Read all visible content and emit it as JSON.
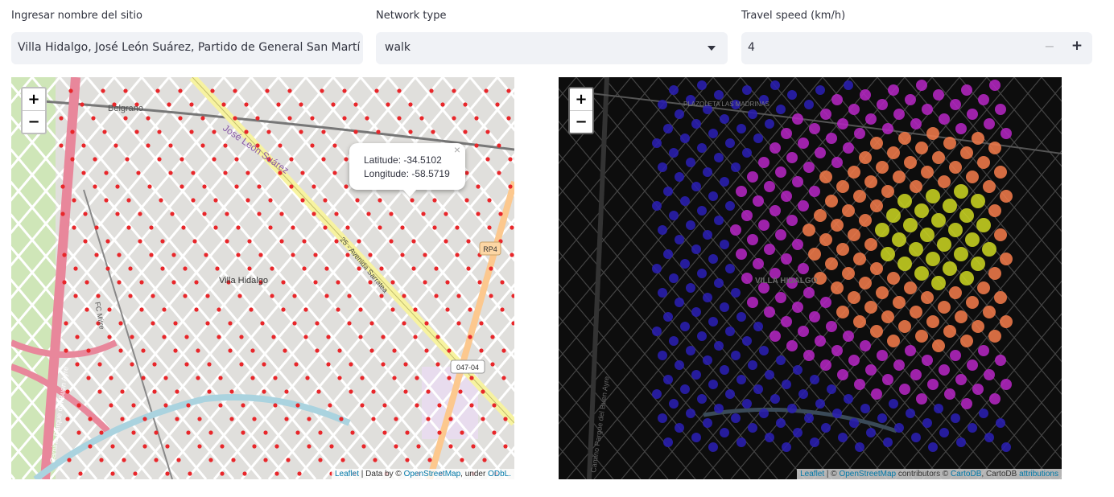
{
  "controls": {
    "site": {
      "label": "Ingresar nombre del sitio",
      "value": "Villa Hidalgo, José León Suárez, Partido de General San Martín,"
    },
    "network": {
      "label": "Network type",
      "value": "walk"
    },
    "speed": {
      "label": "Travel speed (km/h)",
      "value": "4",
      "minus": "−",
      "plus": "+"
    }
  },
  "map_left": {
    "zoom_in": "+",
    "zoom_out": "−",
    "popup": {
      "latitude": "Latitude: -34.5102",
      "longitude": "Longitude: -58.5719",
      "close": "×"
    },
    "labels": {
      "belgrano": "Belgrano",
      "jose_leon": "José León Suárez",
      "villa": "Villa Hidalgo",
      "rp4": "RP4",
      "route": "047-04",
      "camino": "Camino Parque del Buen Ayre",
      "fc": "FC Mitre",
      "avenue": "25 - Avenida Sarratea"
    },
    "attribution": {
      "leaflet": "Leaflet",
      "mid1": " | Data by © ",
      "osm": "OpenStreetMap",
      "mid2": ", under ",
      "odbl": "ODbL."
    }
  },
  "map_right": {
    "zoom_in": "+",
    "zoom_out": "−",
    "labels": {
      "villa": "VILLA HIDALGO",
      "plaz": "PLAZOLETA LAS MADRINAS",
      "camino": "Camino Parque del Buen Ayre"
    },
    "attribution": {
      "leaflet": "Leaflet",
      "mid1": " | © ",
      "osm": "OpenStreetMap",
      "mid2": " contributors © ",
      "carto": "CartoDB",
      "mid3": ", CartoDB ",
      "attr": "attributions"
    }
  },
  "colors": {
    "left_node": "#e8262a",
    "right_far": "#2a1fb0",
    "right_mid": "#b326c0",
    "right_near": "#f07a4a",
    "right_close": "#c8d321"
  }
}
